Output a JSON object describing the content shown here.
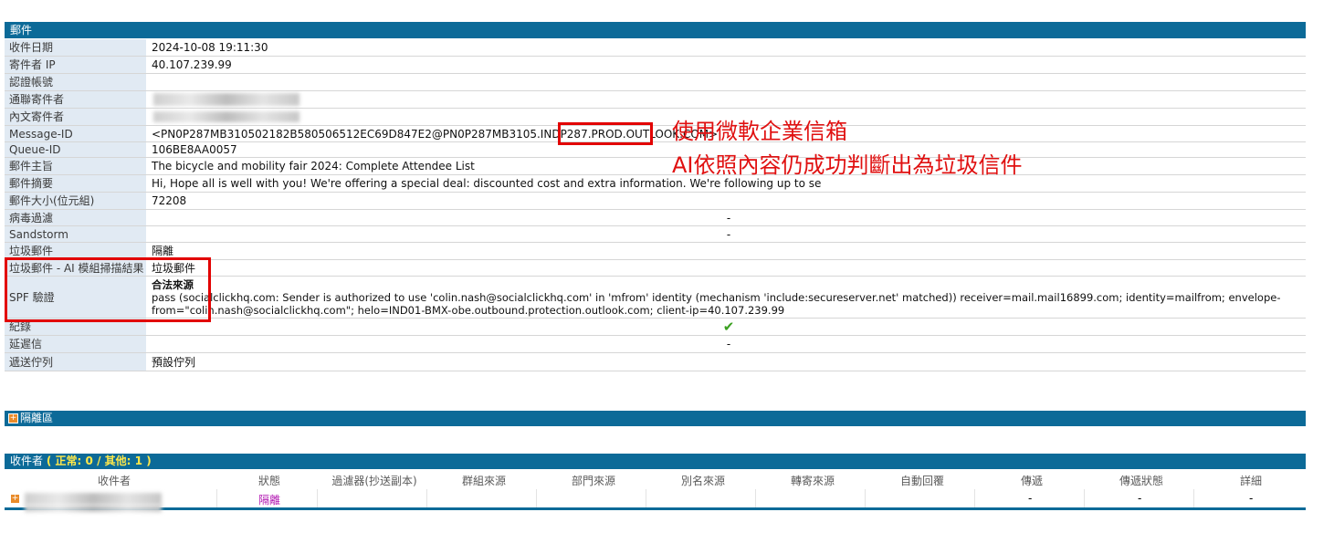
{
  "mail_section": {
    "title": "郵件",
    "received_date": {
      "label": "收件日期",
      "value": "2024-10-08 19:11:30"
    },
    "sender_ip": {
      "label": "寄件者 IP",
      "value": "40.107.239.99"
    },
    "auth_account": {
      "label": "認證帳號",
      "value": ""
    },
    "envelope_sender": {
      "label": "通聯寄件者"
    },
    "header_sender": {
      "label": "內文寄件者"
    },
    "message_id": {
      "label": "Message-ID",
      "value": "<PN0P287MB310502182B580506512EC69D847E2@PN0P287MB3105.INDP287.PROD.OUTLOOK.COM>"
    },
    "queue_id": {
      "label": "Queue-ID",
      "value": "106BE8AA0057"
    },
    "subject": {
      "label": "郵件主旨",
      "value": "The bicycle and mobility fair 2024: Complete Attendee List"
    },
    "summary": {
      "label": "郵件摘要",
      "value": "Hi, Hope all is well with you! We're offering a special deal: discounted cost and extra information. We're following up to se"
    },
    "size": {
      "label": "郵件大小(位元組)",
      "value": "72208"
    },
    "virus_filter": {
      "label": "病毒過濾",
      "value": "-"
    },
    "sandstorm": {
      "label": "Sandstorm",
      "value": "-"
    },
    "spam": {
      "label": "垃圾郵件",
      "value": "隔離"
    },
    "ai_scan": {
      "label": "垃圾郵件 - AI 模組掃描結果",
      "value": "垃圾郵件"
    },
    "spf": {
      "label": "SPF 驗證",
      "result": "合法來源",
      "line1": "pass (socialclickhq.com: Sender is authorized to use 'colin.nash@socialclickhq.com' in 'mfrom' identity (mechanism 'include:secureserver.net' matched)) receiver=mail.mail16899.com; identity=mailfrom; envelope-",
      "line2": "from=\"colin.nash@socialclickhq.com\"; helo=IND01-BMX-obe.outbound.protection.outlook.com; client-ip=40.107.239.99"
    },
    "log": {
      "label": "紀錄",
      "icon": "check-icon"
    },
    "delayed": {
      "label": "延遲信",
      "value": "-"
    },
    "queue": {
      "label": "遞送佇列",
      "value": "預設佇列"
    }
  },
  "annotations": {
    "line1": "使用微軟企業信箱",
    "line2": "AI依照內容仍成功判斷出為垃圾信件"
  },
  "quarantine_section": {
    "title": "隔離區"
  },
  "recipients_section": {
    "title": "收件者",
    "stats_open": "(",
    "normal_label": "正常:",
    "normal_count": "0",
    "sep": "/",
    "other_label": "其他:",
    "other_count": "1",
    "stats_close": ")",
    "columns": [
      "收件者",
      "狀態",
      "過濾器(抄送副本)",
      "群組來源",
      "部門來源",
      "別名來源",
      "轉寄來源",
      "自動回覆",
      "傳遞",
      "傳遞狀態",
      "詳細"
    ],
    "rows": [
      {
        "status": "隔離",
        "delivery": "-",
        "delivery_status": "-",
        "detail": "-"
      }
    ]
  },
  "colors": {
    "header_bar": "#0c6a98",
    "label_bg": "#e1eaf3",
    "annotation": "#e01010",
    "status_purple": "#b014b0",
    "queue_orange": "#d07a1c"
  }
}
